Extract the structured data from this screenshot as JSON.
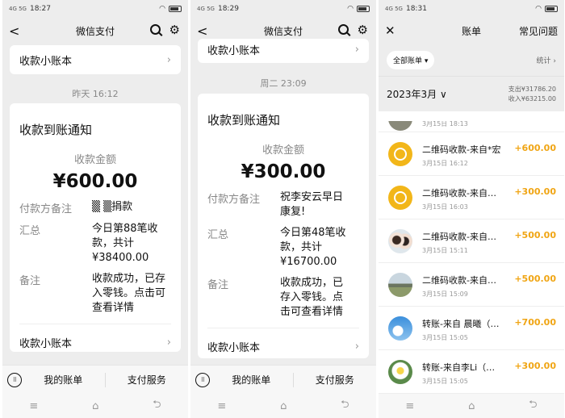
{
  "colors": {
    "income": "#f0a514",
    "gold_icon": "#f2b619"
  },
  "screens": [
    {
      "status": {
        "network": "4G 5G",
        "time": "18:27"
      },
      "nav": {
        "back": "<",
        "title": "微信支付"
      },
      "top_ledger_label": "收款小账本",
      "timestamp": "昨天 16:12",
      "notice": {
        "title": "收款到账通知",
        "amount_label": "收款金额",
        "amount": "¥600.00",
        "rows": [
          {
            "k": "付款方备注",
            "v": "▒  ▒捐款"
          },
          {
            "k": "汇总",
            "v": "今日第88笔收款，共计¥38400.00"
          },
          {
            "k": "备注",
            "v": "收款成功，已存入零钱。点击可查看详情"
          }
        ],
        "ledger_label": "收款小账本"
      },
      "bottom": {
        "keyboard": "⠿",
        "my_bill": "我的账单",
        "pay_service": "支付服务"
      },
      "sysnav": [
        "≡",
        "⌂",
        "⮌"
      ]
    },
    {
      "status": {
        "network": "4G 5G",
        "time": "18:29"
      },
      "nav": {
        "back": "<",
        "title": "微信支付"
      },
      "top_ledger_label": "收款小账本",
      "timestamp": "周二 23:09",
      "notice": {
        "title": "收款到账通知",
        "amount_label": "收款金额",
        "amount": "¥300.00",
        "rows": [
          {
            "k": "付款方备注",
            "v": "祝李安云早日康复!"
          },
          {
            "k": "汇总",
            "v": "今日第48笔收款，共计¥16700.00"
          },
          {
            "k": "备注",
            "v": "收款成功，已存入零钱。点击可查看详情"
          }
        ],
        "ledger_label": "收款小账本"
      },
      "bottom": {
        "keyboard": "⠿",
        "my_bill": "我的账单",
        "pay_service": "支付服务"
      },
      "sysnav": [
        "≡",
        "⌂",
        "⮌"
      ]
    }
  ],
  "bill_screen": {
    "status": {
      "network": "4G 5G",
      "time": "18:31"
    },
    "nav": {
      "close": "✕",
      "title": "账单",
      "faq": "常见问题"
    },
    "filter": "全部账单 ▾",
    "stats": "统计 ›",
    "month": "2023年3月 ∨",
    "expense": "支出¥31786.20",
    "income": "收入¥63215.00",
    "partial_date": "3月15日 18:13",
    "transactions": [
      {
        "name": "二维码收款-来自*宏",
        "date": "3月15日 16:12",
        "amount": "+600.00",
        "icon": "gold-coin-icon"
      },
      {
        "name": "二维码收款-来自…",
        "date": "3月15日 16:03",
        "amount": "+300.00",
        "icon": "gold-coin-icon"
      },
      {
        "name": "二维码收款-来自…",
        "date": "3月15日 15:11",
        "amount": "+500.00",
        "icon": "avatar-couple"
      },
      {
        "name": "二维码收款-来自…",
        "date": "3月15日 15:09",
        "amount": "+500.00",
        "icon": "avatar-landscape"
      },
      {
        "name": "转账-来自 晨曦（…",
        "date": "3月15日 15:05",
        "amount": "+700.00",
        "icon": "avatar-sky"
      },
      {
        "name": "转账-来自李Li（…",
        "date": "3月15日 15:05",
        "amount": "+300.00",
        "icon": "avatar-flower"
      }
    ],
    "sysnav": [
      "≡",
      "⌂",
      "⮌"
    ]
  }
}
